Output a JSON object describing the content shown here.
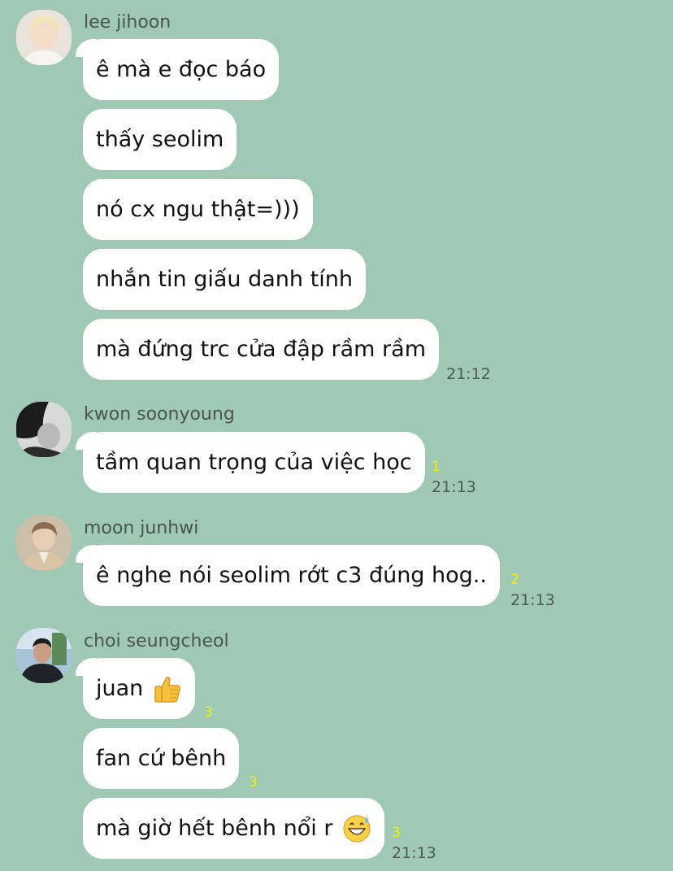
{
  "chat": {
    "groups": [
      {
        "sender": "lee jihoon",
        "messages": [
          "ê mà e đọc báo",
          "thấy seolim",
          "nó cx ngu thật=)))",
          "nhắn tin giấu danh tính",
          "mà đứng trc cửa đập rầm rầm"
        ],
        "time": "21:12"
      },
      {
        "sender": "kwon soonyoung",
        "messages": [
          "tầm quan trọng của việc học"
        ],
        "unread": "1",
        "time": "21:13"
      },
      {
        "sender": "moon junhwi",
        "messages": [
          "ê nghe nói seolim rớt c3 đúng hog.."
        ],
        "unread": "2",
        "time": "21:13"
      },
      {
        "sender": "choi seungcheol",
        "messages": [
          "juan",
          "fan cứ bênh",
          "mà giờ hết bênh nổi r"
        ],
        "unread": [
          "3",
          "3",
          "3"
        ],
        "emojis": [
          "thumbs-up-emoji",
          "sweat-smile-emoji"
        ],
        "time": "21:13"
      }
    ]
  },
  "colors": {
    "background": "#9fc8b5",
    "bubble": "#ffffff",
    "unread": "#f5f000",
    "meta_text": "#4e5b55"
  }
}
